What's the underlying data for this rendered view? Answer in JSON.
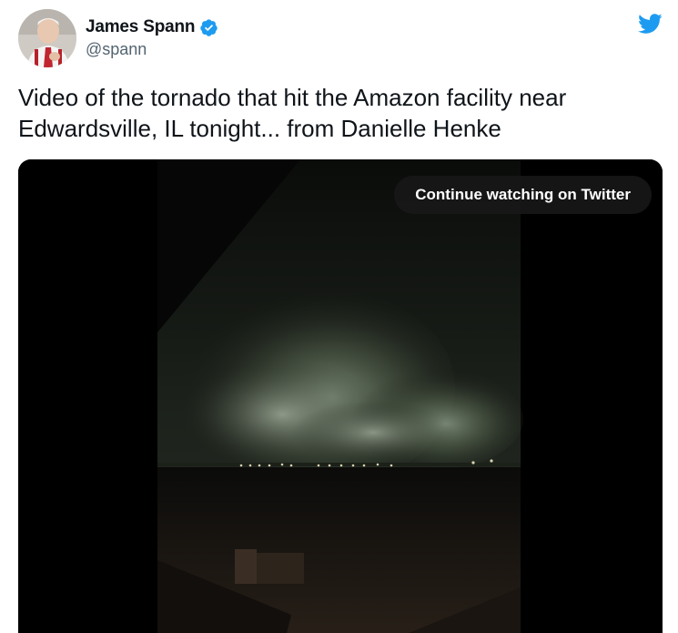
{
  "author": {
    "display_name": "James Spann",
    "handle": "@spann",
    "verified": true,
    "avatar_icon": "profile-photo"
  },
  "brand": {
    "icon": "twitter-bird-icon",
    "color": "#1d9bf0"
  },
  "tweet": {
    "text": "Video of the tornado that hit the Amazon facility near Edwardsville, IL tonight... from Danielle Henke"
  },
  "media": {
    "type": "video",
    "continue_label": "Continue watching on Twitter"
  },
  "colors": {
    "name": "#0f1419",
    "secondary": "#536471",
    "verified": "#1d9bf0",
    "media_bg": "#000000"
  }
}
